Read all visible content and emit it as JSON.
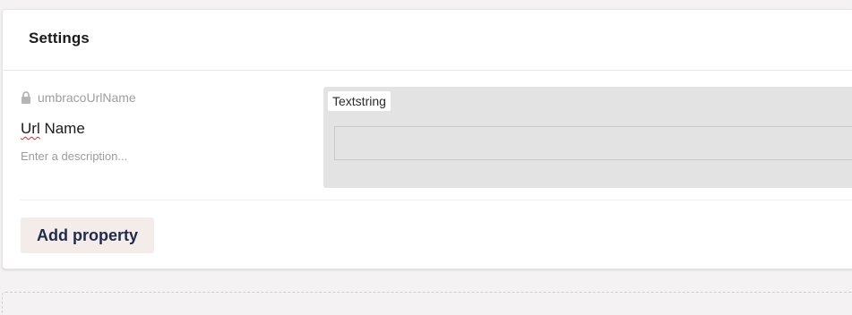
{
  "group": {
    "title": "Settings"
  },
  "property": {
    "alias": "umbracoUrlName",
    "name_first": "Url",
    "name_rest": " Name",
    "description_placeholder": "Enter a description...",
    "editor_label": "Textstring"
  },
  "actions": {
    "add_property_label": "Add property"
  },
  "colors": {
    "page_background": "#f4f2f2",
    "panel_background": "#ffffff",
    "button_background": "#f3ece8",
    "button_text": "#1f2a4d",
    "preview_background": "#e3e3e3",
    "spellcheck_underline": "#d32f2f"
  },
  "icons": {
    "alias_lock": "lock-icon"
  }
}
